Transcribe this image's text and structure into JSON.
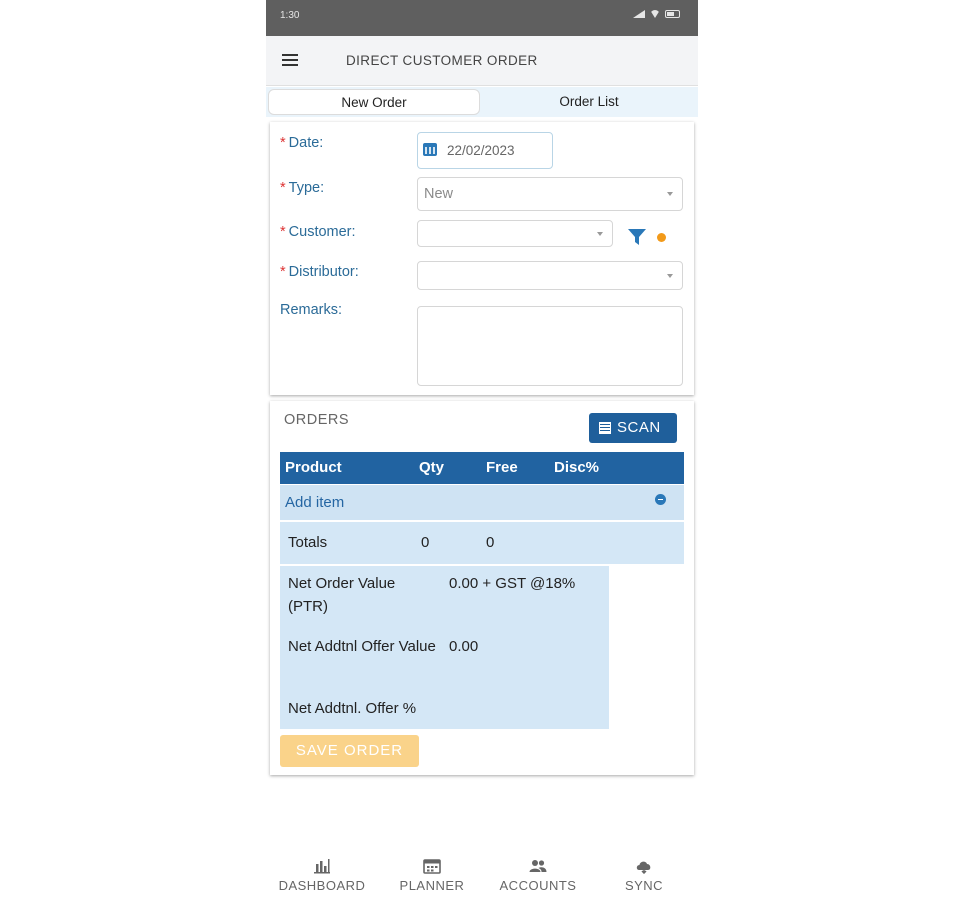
{
  "status_bar": {
    "time": "1:30"
  },
  "header": {
    "title": "DIRECT CUSTOMER ORDER"
  },
  "tabs": [
    {
      "label": "New Order"
    },
    {
      "label": "Order List"
    }
  ],
  "form": {
    "date_label": "Date:",
    "date_value": "22/02/2023",
    "type_label": "Type:",
    "type_value": "New",
    "customer_label": "Customer:",
    "customer_value": "",
    "distributor_label": "Distributor:",
    "distributor_value": "",
    "remarks_label": "Remarks:",
    "required_marker": "*"
  },
  "orders": {
    "title": "ORDERS",
    "scan_label": "SCAN",
    "columns": [
      "Product",
      "Qty",
      "Free",
      "Disc%"
    ],
    "add_item_label": "Add item",
    "totals": {
      "label": "Totals",
      "qty": "0",
      "free": "0"
    },
    "summary": [
      {
        "label": "Net Order Value (PTR)",
        "value": "0.00 + GST @18%"
      },
      {
        "label": "Net Addtnl Offer Value",
        "value": "0.00"
      },
      {
        "label": "Net Addtnl. Offer %",
        "value": ""
      }
    ],
    "save_label": "SAVE ORDER"
  },
  "bottom_nav": [
    {
      "label": "DASHBOARD",
      "icon": "bar-chart-icon"
    },
    {
      "label": "PLANNER",
      "icon": "calendar-icon"
    },
    {
      "label": "ACCOUNTS",
      "icon": "users-icon"
    },
    {
      "label": "SYNC",
      "icon": "cloud-sync-icon"
    }
  ],
  "colors": {
    "primary": "#2163a1",
    "label": "#2b6b98",
    "row_bg": "#d4e7f6",
    "save_disabled": "#fad38a",
    "filter_dot": "#f29a1a"
  }
}
